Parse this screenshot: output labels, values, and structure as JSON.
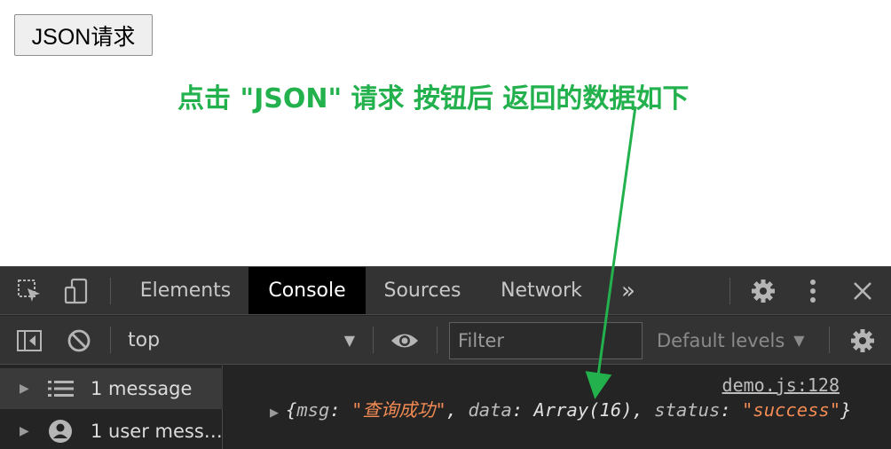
{
  "page": {
    "button_label": "JSON请求",
    "annotation": "点击 \"JSON\" 请求 按钮后 返回的数据如下"
  },
  "devtools": {
    "tabs": [
      "Elements",
      "Console",
      "Sources",
      "Network"
    ],
    "active_tab": "Console",
    "more_tabs": "»",
    "context": "top",
    "filter_placeholder": "Filter",
    "levels": "Default levels",
    "sidebar": [
      {
        "label": "1 message",
        "icon": "list-icon"
      },
      {
        "label": "1 user mess…",
        "icon": "user-icon"
      }
    ],
    "log": {
      "source": "demo.js:128",
      "open": "{",
      "msg_key": "msg",
      "msg_value": "\"查询成功\"",
      "data_key": "data",
      "data_value": "Array(16)",
      "status_key": "status",
      "status_value": "\"success\"",
      "close": "}"
    }
  },
  "colors": {
    "annotation_green": "#22b14c",
    "devtools_bg": "#242424",
    "string_orange": "#f28b54"
  }
}
